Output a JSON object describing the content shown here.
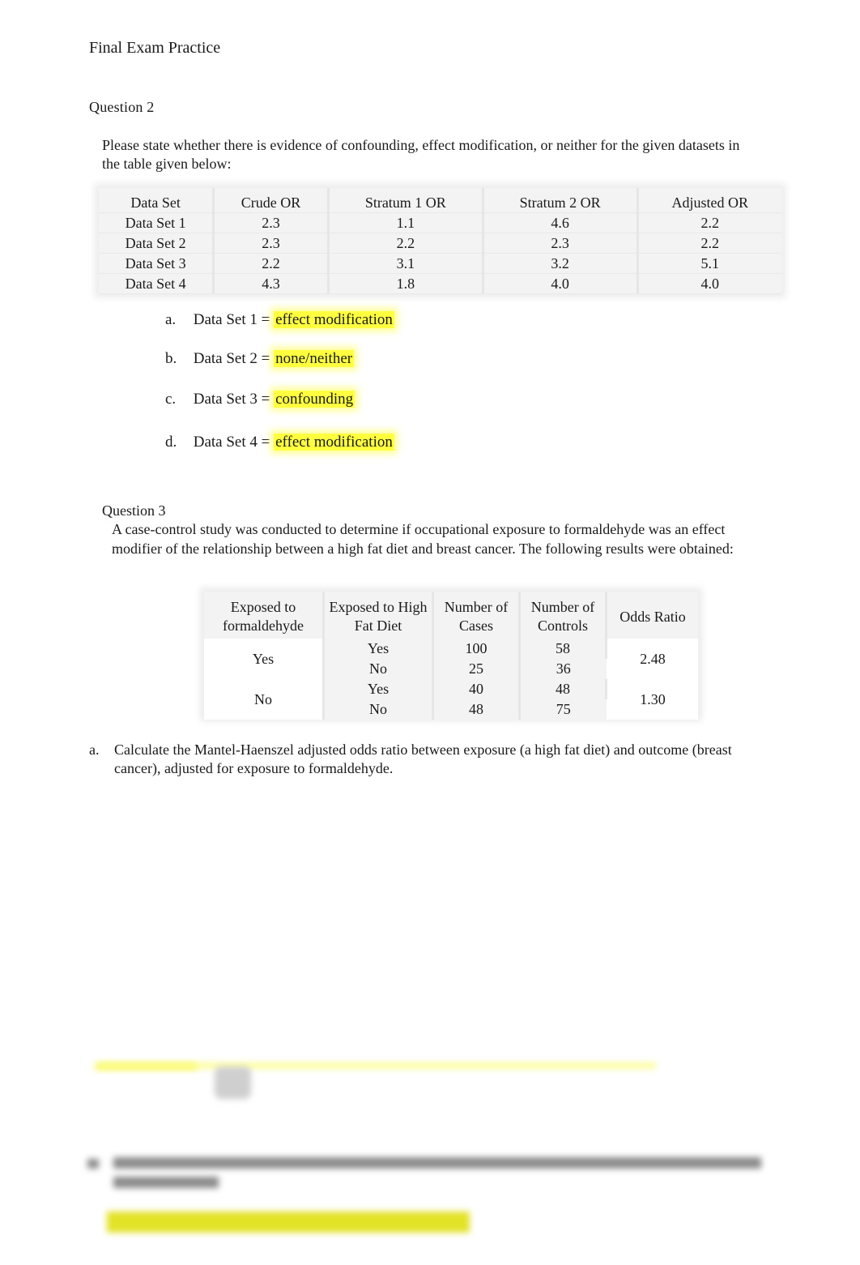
{
  "document": {
    "title": "Final Exam Practice"
  },
  "question2": {
    "label": "Question 2",
    "prompt": "Please state whether there is evidence of confounding, effect modification, or neither for the given datasets in the table given below:",
    "table": {
      "headers": [
        "Data Set",
        "Crude OR",
        "Stratum 1 OR",
        "Stratum 2 OR",
        "Adjusted OR"
      ],
      "rows": [
        [
          "Data Set 1",
          "2.3",
          "1.1",
          "4.6",
          "2.2"
        ],
        [
          "Data Set 2",
          "2.3",
          "2.2",
          "2.3",
          "2.2"
        ],
        [
          "Data Set 3",
          "2.2",
          "3.1",
          "3.2",
          "5.1"
        ],
        [
          "Data Set 4",
          "4.3",
          "1.8",
          "4.0",
          "4.0"
        ]
      ]
    },
    "answers": [
      {
        "letter": "a.",
        "prefix": "Data Set 1 =",
        "answer": "effect modification"
      },
      {
        "letter": "b.",
        "prefix": "Data Set 2 =",
        "answer": "none/neither"
      },
      {
        "letter": "c.",
        "prefix": "Data Set 3 =",
        "answer": "confounding"
      },
      {
        "letter": "d.",
        "prefix": "Data Set 4 =",
        "answer": "effect modification"
      }
    ],
    "highlight_color": "#ffff40"
  },
  "question3": {
    "label": "Question 3",
    "prompt": "A case-control study was conducted to determine if occupational exposure to formaldehyde was an effect modifier of the relationship between a high fat diet and breast cancer. The following results were obtained:",
    "table": {
      "headers": [
        "Exposed to formaldehyde",
        "Exposed to High Fat Diet",
        "Number of Cases",
        "Number of Controls",
        "Odds Ratio"
      ],
      "strata": [
        {
          "formaldehyde": "Yes",
          "odds_ratio": "2.48",
          "rows": [
            {
              "high_fat_diet": "Yes",
              "cases": "100",
              "controls": "58"
            },
            {
              "high_fat_diet": "No",
              "cases": "25",
              "controls": "36"
            }
          ]
        },
        {
          "formaldehyde": "No",
          "odds_ratio": "1.30",
          "rows": [
            {
              "high_fat_diet": "Yes",
              "cases": "40",
              "controls": "48"
            },
            {
              "high_fat_diet": "No",
              "cases": "48",
              "controls": "75"
            }
          ]
        }
      ]
    },
    "part_a": {
      "letter": "a.",
      "text": "Calculate the Mantel-Haenszel adjusted odds ratio between exposure (a high fat diet) and outcome (breast cancer), adjusted for exposure to formaldehyde."
    },
    "part_b": {
      "letter": "b."
    }
  }
}
